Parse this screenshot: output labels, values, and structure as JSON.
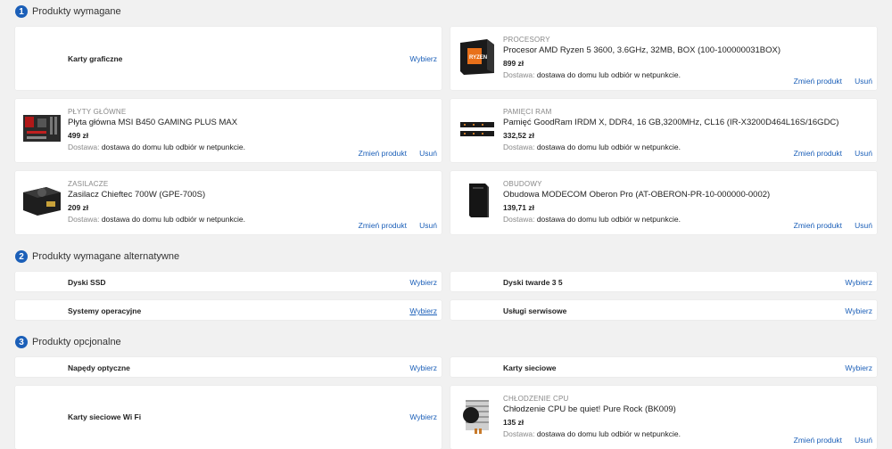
{
  "sections": [
    {
      "number": "1",
      "title": "Produkty wymagane"
    },
    {
      "number": "2",
      "title": "Produkty wymagane alternatywne"
    },
    {
      "number": "3",
      "title": "Produkty opcjonalne"
    }
  ],
  "actions": {
    "choose": "Wybierz",
    "change": "Zmień produkt",
    "remove": "Usuń"
  },
  "delivery": {
    "label": "Dostawa:",
    "text": "dostawa do domu lub odbiór w netpunkcie."
  },
  "required": {
    "gpu": {
      "category": "Karty graficzne"
    },
    "cpu": {
      "category": "PROCESORY",
      "name": "Procesor AMD Ryzen 5 3600, 3.6GHz, 32MB, BOX (100-100000031BOX)",
      "price": "899 zł",
      "image": "cpu-box-image"
    },
    "mobo": {
      "category": "PŁYTY GŁÓWNE",
      "name": "Płyta główna MSI B450 GAMING PLUS MAX",
      "price": "499 zł",
      "image": "motherboard-image"
    },
    "ram": {
      "category": "PAMIĘCI RAM",
      "name": "Pamięć GoodRam IRDM X, DDR4, 16 GB,3200MHz, CL16 (IR-X3200D464L16S/16GDC)",
      "price": "332,52 zł",
      "image": "ram-image"
    },
    "psu": {
      "category": "ZASILACZE",
      "name": "Zasilacz Chieftec 700W (GPE-700S)",
      "price": "209 zł",
      "image": "psu-image"
    },
    "case": {
      "category": "OBUDOWY",
      "name": "Obudowa MODECOM Oberon Pro (AT-OBERON-PR-10-000000-0002)",
      "price": "139,71 zł",
      "image": "case-image"
    }
  },
  "alternatives": {
    "ssd": "Dyski SSD",
    "hdd": "Dyski twarde 3 5",
    "os": "Systemy operacyjne",
    "service": "Usługi serwisowe"
  },
  "optional": {
    "optical": "Napędy optyczne",
    "network": "Karty sieciowe",
    "wifi": "Karty sieciowe Wi Fi",
    "cooler": {
      "category": "CHŁODZENIE CPU",
      "name": "Chłodzenie CPU be quiet! Pure Rock (BK009)",
      "price": "135 zł",
      "image": "cpu-cooler-image"
    }
  }
}
